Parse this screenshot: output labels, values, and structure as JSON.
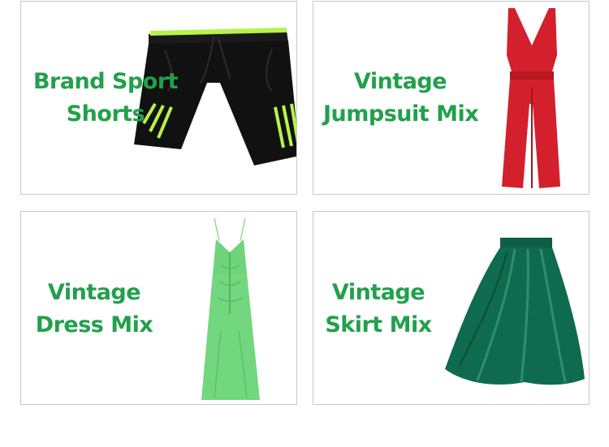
{
  "categories": [
    {
      "line1": "Brand Sport",
      "line2": "Shorts",
      "image": "black-sport-shorts-image"
    },
    {
      "line1": "Vintage",
      "line2": "Jumpsuit Mix",
      "image": "red-jumpsuit-image"
    },
    {
      "line1": "Vintage",
      "line2": "Dress Mix",
      "image": "green-dress-image"
    },
    {
      "line1": "Vintage",
      "line2": "Skirt Mix",
      "image": "green-satin-skirt-image"
    }
  ],
  "colors": {
    "label": "#22a04b",
    "border": "#c9c9c9",
    "shorts": "#111111",
    "shorts_stripe": "#b8f24a",
    "jumpsuit": "#d4202d",
    "dress": "#72d77f",
    "skirt": "#0f6b4d"
  }
}
